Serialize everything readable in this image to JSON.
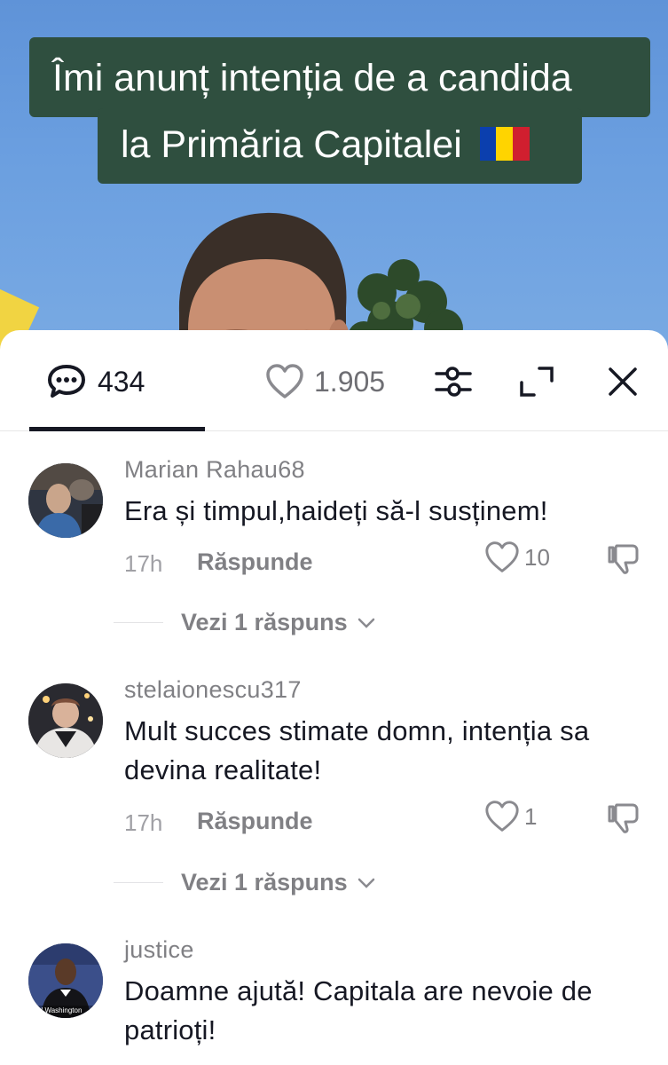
{
  "video": {
    "caption_line1": "Îmi anunț intenția de a candida",
    "caption_line2": "la Primăria Capitalei",
    "caption_emoji": "romania-flag-icon",
    "flag_colors": [
      "#0b3fae",
      "#ffd400",
      "#d01f2f"
    ],
    "caption_bg": "#2f4f3f"
  },
  "toolbar": {
    "comment_count": "434",
    "like_count": "1.905",
    "icons": [
      "comment-icon",
      "heart-icon",
      "filter-icon",
      "expand-icon",
      "close-icon"
    ]
  },
  "comments": [
    {
      "username": "Marian Rahau68",
      "text": "Era și timpul,haideți să-l susținem!",
      "time": "17h",
      "reply_label": "Răspunde",
      "likes": "10",
      "view_replies": "Vezi 1 răspuns"
    },
    {
      "username": "stelaionescu317",
      "text": "Mult succes stimate domn, intenția sa devina realitate!",
      "time": "17h",
      "reply_label": "Răspunde",
      "likes": "1",
      "view_replies": "Vezi 1 răspuns"
    },
    {
      "username": "justice",
      "text": "Doamne ajută! Capitala are nevoie de patrioți!",
      "avatar_caption": "zel Washington"
    }
  ]
}
